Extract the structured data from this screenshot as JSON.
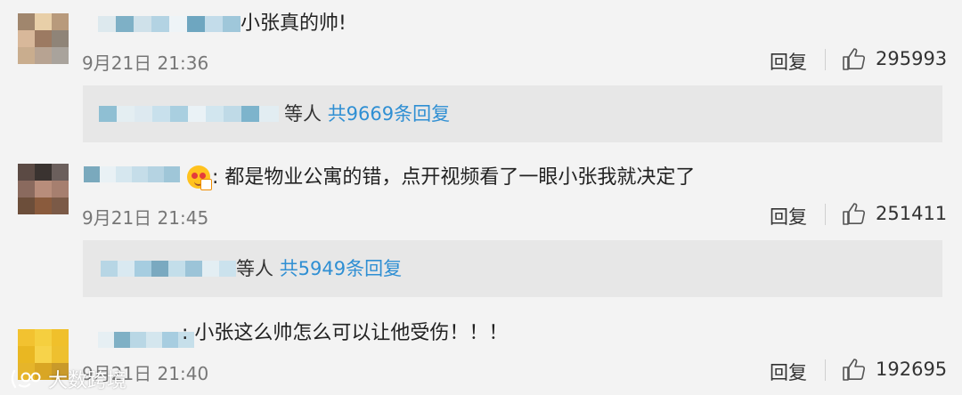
{
  "comments": [
    {
      "text": "小张真的帅!",
      "time": "9月21日 21:36",
      "reply_label": "回复",
      "likes": "295993",
      "replies": {
        "suffix": "等人",
        "link": "共9669条回复"
      }
    },
    {
      "text": ":  都是物业公寓的错，点开视频看了一眼小张我就决定了",
      "time": "9月21日 21:45",
      "reply_label": "回复",
      "likes": "251411",
      "replies": {
        "suffix": "等人",
        "link": "共5949条回复"
      }
    },
    {
      "text": ":  小张这么帅怎么可以让他受伤！！！",
      "time": "9月21日 21:40",
      "reply_label": "回复",
      "likes": "192695"
    }
  ],
  "watermark": {
    "text": "大数跨境"
  },
  "icons": {
    "like": "thumbs-up-icon",
    "emoji": "heart-eyes-emoji-icon",
    "watermark": "brand-logo-icon"
  }
}
